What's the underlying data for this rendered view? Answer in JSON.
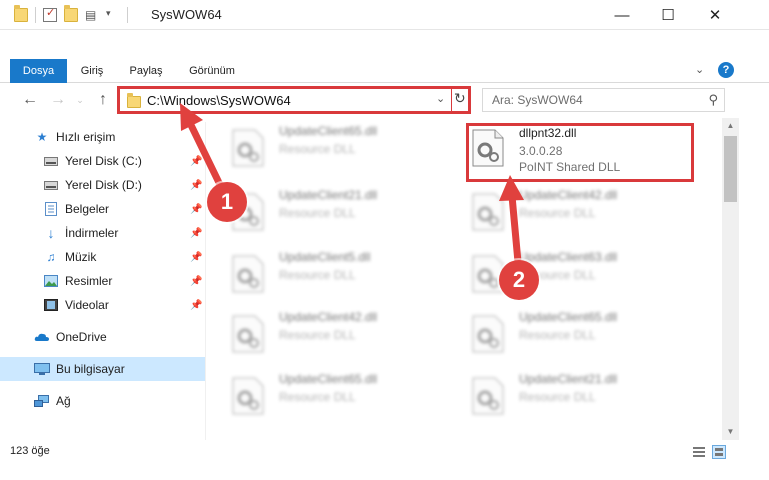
{
  "window": {
    "title": "SysWOW64",
    "minimize": "—",
    "maximize": "☐",
    "close": "✕"
  },
  "ribbon": {
    "tabs": [
      {
        "label": "Dosya"
      },
      {
        "label": "Giriş"
      },
      {
        "label": "Paylaş"
      },
      {
        "label": "Görünüm"
      }
    ],
    "help": "?"
  },
  "address": {
    "path": "C:\\Windows\\SysWOW64",
    "search_placeholder": "Ara: SysWOW64"
  },
  "sidebar": {
    "items": [
      {
        "label": "Hızlı erişim",
        "icon": "star-icon"
      },
      {
        "label": "Yerel Disk (C:)",
        "icon": "drive-icon"
      },
      {
        "label": "Yerel Disk (D:)",
        "icon": "drive-icon"
      },
      {
        "label": "Belgeler",
        "icon": "documents-icon"
      },
      {
        "label": "İndirmeler",
        "icon": "downloads-icon"
      },
      {
        "label": "Müzik",
        "icon": "music-icon"
      },
      {
        "label": "Resimler",
        "icon": "pictures-icon"
      },
      {
        "label": "Videolar",
        "icon": "videos-icon"
      },
      {
        "label": "OneDrive",
        "icon": "cloud-icon"
      },
      {
        "label": "Bu bilgisayar",
        "icon": "computer-icon"
      },
      {
        "label": "Ağ",
        "icon": "network-icon"
      }
    ]
  },
  "files": {
    "col1": [
      {
        "name": "UpdateClient65.dll",
        "type": "Resource DLL"
      },
      {
        "name": "UpdateClient21.dll",
        "type": "Resource DLL"
      },
      {
        "name": "UpdateClient5.dll",
        "type": "Resource DLL"
      },
      {
        "name": "UpdateClient42.dll",
        "type": "Resource DLL"
      },
      {
        "name": "UpdateClient65.dll",
        "type": "Resource DLL"
      }
    ],
    "col2": [
      {
        "name": "UpdateClient42.dll",
        "type": "Resource DLL"
      },
      {
        "name": "UpdateClient63.dll",
        "type": "Resource DLL"
      },
      {
        "name": "UpdateClient65.dll",
        "type": "Resource DLL"
      },
      {
        "name": "UpdateClient21.dll",
        "type": "Resource DLL"
      }
    ],
    "featured": {
      "name": "dllpnt32.dll",
      "version": "3.0.0.28",
      "description": "PoINT Shared DLL"
    }
  },
  "status": {
    "count": "123 öğe"
  },
  "callouts": {
    "one": "1",
    "two": "2"
  },
  "colors": {
    "accent": "#1979ca",
    "callout": "#e0413e",
    "selection": "#cce8ff"
  }
}
